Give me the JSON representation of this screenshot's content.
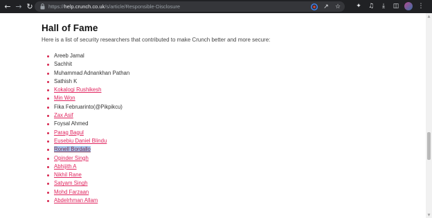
{
  "browser": {
    "url_prefix": "https://",
    "url_host": "help.crunch.co.uk",
    "url_path": "/s/article/Responsible-Disclosure"
  },
  "page": {
    "heading": "Hall of Fame",
    "intro": "Here is a list of security researchers that contributed to make Crunch better and more secure:"
  },
  "researchers": [
    {
      "name": "Areeb Jamal",
      "is_link": false
    },
    {
      "name": "Sachhit",
      "is_link": false
    },
    {
      "name": "Muhammad Adnankhan Pathan",
      "is_link": false
    },
    {
      "name": "Sathish K",
      "is_link": false
    },
    {
      "name": "Kokalogi Rushikesh",
      "is_link": true
    },
    {
      "name": "Min Won",
      "is_link": true
    },
    {
      "name": "Fika Februarinto(@Pikpikcu)",
      "is_link": false
    },
    {
      "name": "Zax Asif",
      "is_link": true
    },
    {
      "name": "Foysal Ahmed",
      "is_link": false
    },
    {
      "name": "Parag Bagul",
      "is_link": true
    },
    {
      "name": "Eusebiu Daniel Blindu",
      "is_link": true
    },
    {
      "name": "Ronell Bordallo",
      "is_link": true,
      "selected": true
    },
    {
      "name": "Opinder Singh",
      "is_link": true
    },
    {
      "name": "Abhijith A",
      "is_link": true
    },
    {
      "name": "Nikhil Rane",
      "is_link": true
    },
    {
      "name": "Satyam Singh",
      "is_link": true
    },
    {
      "name": "Mohd Farzaan",
      "is_link": true
    },
    {
      "name": "Abdelrhman Allam",
      "is_link": true
    }
  ],
  "colors": {
    "link": "#e0245e",
    "bullet": "#d7264f",
    "selection": "#a9c8f0"
  }
}
